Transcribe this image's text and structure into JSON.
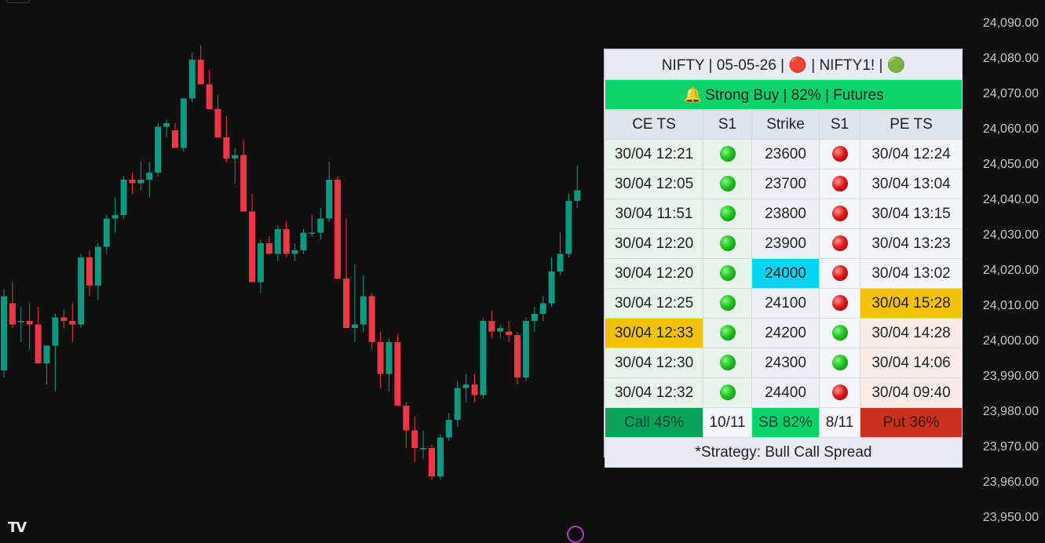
{
  "chart_data": {
    "type": "candlestick",
    "y_ticks": [
      "24,090.00",
      "24,080.00",
      "24,070.00",
      "24,060.00",
      "24,050.00",
      "24,040.00",
      "24,030.00",
      "24,020.00",
      "24,010.00",
      "24,000.00",
      "23,990.00",
      "23,980.00",
      "23,970.00",
      "23,960.00",
      "23,950.00"
    ],
    "ylim": [
      23947,
      24097
    ],
    "colors": {
      "up": "#089981",
      "down": "#f23645"
    },
    "candles": [
      {
        "o": 23992,
        "h": 24015,
        "l": 23990,
        "c": 24013
      },
      {
        "o": 24011,
        "h": 24017,
        "l": 24004,
        "c": 24005
      },
      {
        "o": 24006,
        "h": 24010,
        "l": 24000,
        "c": 24006
      },
      {
        "o": 24006,
        "h": 24011,
        "l": 23998,
        "c": 24005
      },
      {
        "o": 24005,
        "h": 24010,
        "l": 23995,
        "c": 23994
      },
      {
        "o": 23994,
        "h": 23998,
        "l": 23988,
        "c": 23999
      },
      {
        "o": 23999,
        "h": 24008,
        "l": 23986,
        "c": 24007
      },
      {
        "o": 24007,
        "h": 24009,
        "l": 24004,
        "c": 24006
      },
      {
        "o": 24006,
        "h": 24011,
        "l": 24000,
        "c": 24005
      },
      {
        "o": 24005,
        "h": 24025,
        "l": 24004,
        "c": 24024
      },
      {
        "o": 24024,
        "h": 24026,
        "l": 24013,
        "c": 24016
      },
      {
        "o": 24016,
        "h": 24028,
        "l": 24012,
        "c": 24027
      },
      {
        "o": 24027,
        "h": 24036,
        "l": 24025,
        "c": 24035
      },
      {
        "o": 24035,
        "h": 24041,
        "l": 24031,
        "c": 24036
      },
      {
        "o": 24036,
        "h": 24047,
        "l": 24035,
        "c": 24046
      },
      {
        "o": 24046,
        "h": 24048,
        "l": 24042,
        "c": 24045
      },
      {
        "o": 24045,
        "h": 24051,
        "l": 24043,
        "c": 24046
      },
      {
        "o": 24046,
        "h": 24051,
        "l": 24041,
        "c": 24048
      },
      {
        "o": 24048,
        "h": 24062,
        "l": 24047,
        "c": 24061
      },
      {
        "o": 24061,
        "h": 24063,
        "l": 24058,
        "c": 24062
      },
      {
        "o": 24060,
        "h": 24062,
        "l": 24055,
        "c": 24055
      },
      {
        "o": 24055,
        "h": 24069,
        "l": 24054,
        "c": 24069
      },
      {
        "o": 24069,
        "h": 24082,
        "l": 24068,
        "c": 24080
      },
      {
        "o": 24080,
        "h": 24084,
        "l": 24073,
        "c": 24073
      },
      {
        "o": 24073,
        "h": 24077,
        "l": 24066,
        "c": 24066
      },
      {
        "o": 24066,
        "h": 24070,
        "l": 24058,
        "c": 24058
      },
      {
        "o": 24058,
        "h": 24064,
        "l": 24051,
        "c": 24052
      },
      {
        "o": 24052,
        "h": 24055,
        "l": 24045,
        "c": 24053
      },
      {
        "o": 24053,
        "h": 24057,
        "l": 24037,
        "c": 24037
      },
      {
        "o": 24037,
        "h": 24042,
        "l": 24017,
        "c": 24017
      },
      {
        "o": 24017,
        "h": 24029,
        "l": 24014,
        "c": 24028
      },
      {
        "o": 24028,
        "h": 24030,
        "l": 24025,
        "c": 24025
      },
      {
        "o": 24025,
        "h": 24033,
        "l": 24023,
        "c": 24032
      },
      {
        "o": 24032,
        "h": 24034,
        "l": 24024,
        "c": 24025
      },
      {
        "o": 24025,
        "h": 24028,
        "l": 24023,
        "c": 24026
      },
      {
        "o": 24026,
        "h": 24032,
        "l": 24025,
        "c": 24031
      },
      {
        "o": 24031,
        "h": 24036,
        "l": 24030,
        "c": 24031
      },
      {
        "o": 24031,
        "h": 24038,
        "l": 24029,
        "c": 24035
      },
      {
        "o": 24035,
        "h": 24051,
        "l": 24034,
        "c": 24046
      },
      {
        "o": 24046,
        "h": 24047,
        "l": 24018,
        "c": 24018
      },
      {
        "o": 24018,
        "h": 24035,
        "l": 24010,
        "c": 24004
      },
      {
        "o": 24004,
        "h": 24022,
        "l": 24000,
        "c": 24005
      },
      {
        "o": 24005,
        "h": 24019,
        "l": 24003,
        "c": 24013
      },
      {
        "o": 24013,
        "h": 24014,
        "l": 23998,
        "c": 24000
      },
      {
        "o": 24000,
        "h": 24003,
        "l": 23987,
        "c": 23991
      },
      {
        "o": 23991,
        "h": 24001,
        "l": 23986,
        "c": 24000
      },
      {
        "o": 24000,
        "h": 24002,
        "l": 23982,
        "c": 23982
      },
      {
        "o": 23982,
        "h": 23983,
        "l": 23970,
        "c": 23975
      },
      {
        "o": 23975,
        "h": 23979,
        "l": 23966,
        "c": 23970
      },
      {
        "o": 23970,
        "h": 23975,
        "l": 23967,
        "c": 23970
      },
      {
        "o": 23970,
        "h": 23971,
        "l": 23961,
        "c": 23962
      },
      {
        "o": 23962,
        "h": 23974,
        "l": 23961,
        "c": 23973
      },
      {
        "o": 23973,
        "h": 23980,
        "l": 23972,
        "c": 23978
      },
      {
        "o": 23978,
        "h": 23989,
        "l": 23976,
        "c": 23987
      },
      {
        "o": 23987,
        "h": 23991,
        "l": 23983,
        "c": 23988
      },
      {
        "o": 23988,
        "h": 23991,
        "l": 23983,
        "c": 23985
      },
      {
        "o": 23985,
        "h": 24007,
        "l": 23984,
        "c": 24006
      },
      {
        "o": 24006,
        "h": 24009,
        "l": 24001,
        "c": 24003
      },
      {
        "o": 24003,
        "h": 24005,
        "l": 24001,
        "c": 24004
      },
      {
        "o": 24003,
        "h": 24006,
        "l": 24000,
        "c": 24002
      },
      {
        "o": 24002,
        "h": 24003,
        "l": 23988,
        "c": 23990
      },
      {
        "o": 23990,
        "h": 24007,
        "l": 23989,
        "c": 24006
      },
      {
        "o": 24006,
        "h": 24010,
        "l": 24003,
        "c": 24008
      },
      {
        "o": 24008,
        "h": 24013,
        "l": 24006,
        "c": 24011
      },
      {
        "o": 24011,
        "h": 24024,
        "l": 24010,
        "c": 24020
      },
      {
        "o": 24020,
        "h": 24031,
        "l": 24019,
        "c": 24025
      },
      {
        "o": 24025,
        "h": 24042,
        "l": 24024,
        "c": 24040
      },
      {
        "o": 24040,
        "h": 24050,
        "l": 24038,
        "c": 24043
      }
    ]
  },
  "table": {
    "header": "NIFTY | 05-05-26 | 🔴 | NIFTY1! | 🟢",
    "signal": "Strong Buy | 82% | Futures",
    "columns": [
      "CE TS",
      "S1",
      "Strike",
      "S1",
      "PE TS"
    ],
    "rows": [
      {
        "ce_ts": "30/04 12:21",
        "ce_s1": "green",
        "strike": "23600",
        "pe_s1": "red",
        "pe_ts": "30/04 12:24"
      },
      {
        "ce_ts": "30/04 12:05",
        "ce_s1": "green",
        "strike": "23700",
        "pe_s1": "red",
        "pe_ts": "30/04 13:04"
      },
      {
        "ce_ts": "30/04 11:51",
        "ce_s1": "green",
        "strike": "23800",
        "pe_s1": "red",
        "pe_ts": "30/04 13:15"
      },
      {
        "ce_ts": "30/04 12:20",
        "ce_s1": "green",
        "strike": "23900",
        "pe_s1": "red",
        "pe_ts": "30/04 13:23"
      },
      {
        "ce_ts": "30/04 12:20",
        "ce_s1": "green",
        "strike": "24000",
        "pe_s1": "red",
        "pe_ts": "30/04 13:02"
      },
      {
        "ce_ts": "30/04 12:25",
        "ce_s1": "green",
        "strike": "24100",
        "pe_s1": "red",
        "pe_ts": "30/04 15:28"
      },
      {
        "ce_ts": "30/04 12:33",
        "ce_s1": "green",
        "strike": "24200",
        "pe_s1": "green",
        "pe_ts": "30/04 14:28"
      },
      {
        "ce_ts": "30/04 12:30",
        "ce_s1": "green",
        "strike": "24300",
        "pe_s1": "green",
        "pe_ts": "30/04 14:06"
      },
      {
        "ce_ts": "30/04 12:32",
        "ce_s1": "green",
        "strike": "24400",
        "pe_s1": "red",
        "pe_ts": "30/04 09:40"
      }
    ],
    "summary": {
      "call": "Call 45%",
      "call_frac": "10/11",
      "sb": "SB 82%",
      "put_frac": "8/11",
      "put": "Put 36%"
    },
    "footer": "*Strategy: Bull Call Spread"
  },
  "icons": {
    "bell": "bell-icon",
    "logo": "tradingview-logo",
    "lightning": "lightning-icon"
  }
}
